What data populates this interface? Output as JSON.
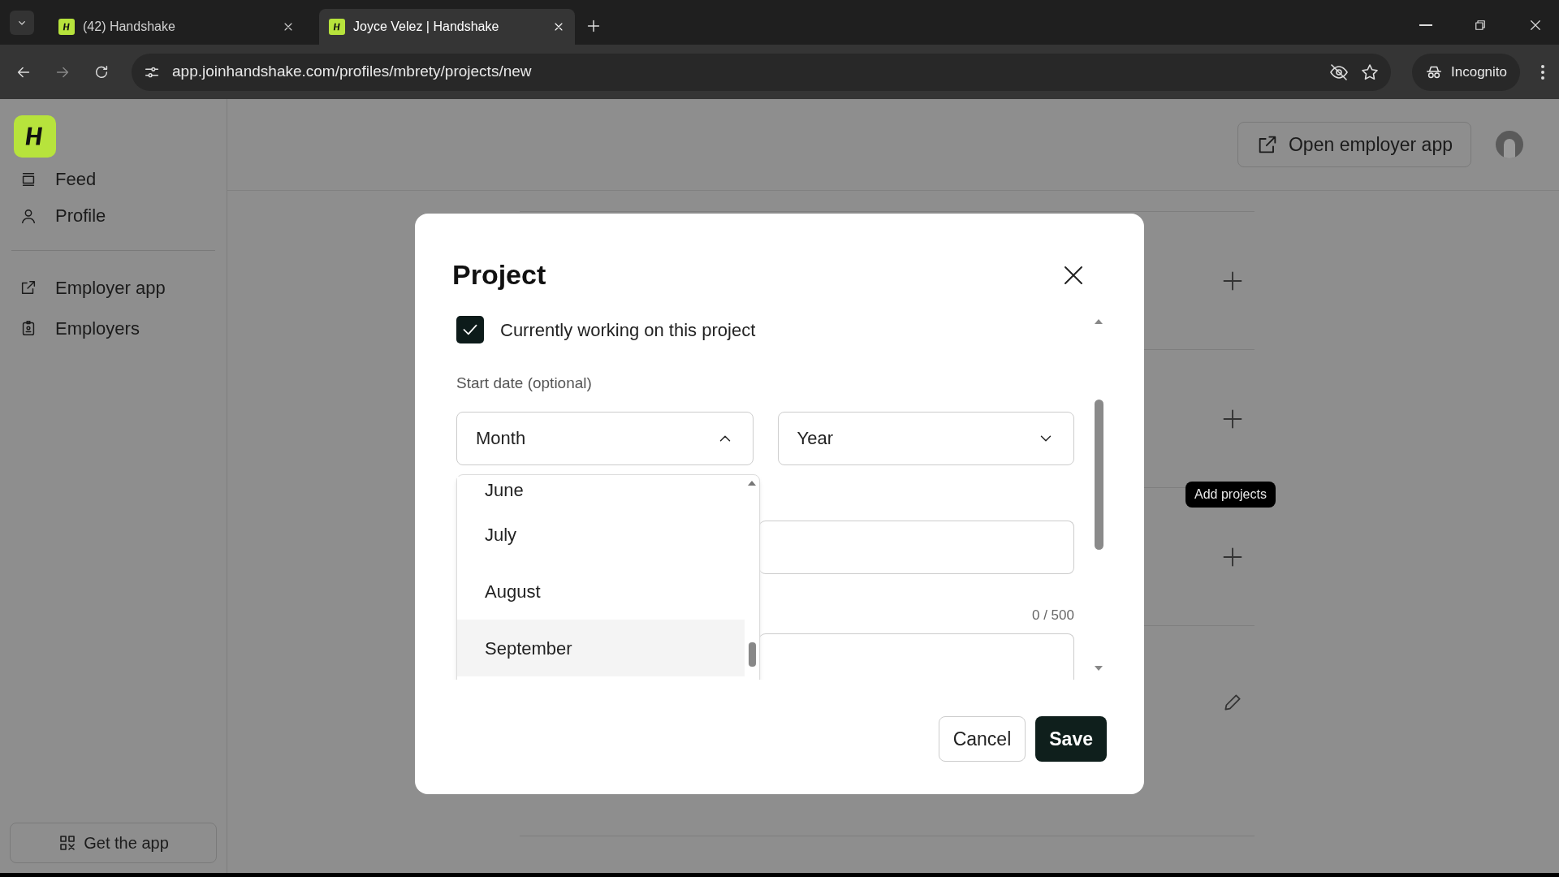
{
  "browser": {
    "tabs": [
      {
        "title": "(42) Handshake",
        "selected": false
      },
      {
        "title": "Joyce Velez | Handshake",
        "selected": true
      }
    ],
    "url": "app.joinhandshake.com/profiles/mbrety/projects/new",
    "profile_label": "Incognito"
  },
  "sidebar": {
    "items": [
      {
        "label": "Feed",
        "kind": "main"
      },
      {
        "label": "Profile",
        "kind": "main"
      },
      {
        "label": "Employer app",
        "kind": "extra"
      },
      {
        "label": "Employers",
        "kind": "extra"
      }
    ],
    "get_app": "Get the app"
  },
  "header": {
    "open_employer_button": "Open employer app"
  },
  "sections": [
    {
      "kind": "add"
    },
    {
      "kind": "add"
    },
    {
      "kind": "add"
    },
    {
      "kind": "edit"
    }
  ],
  "tooltip": "Add projects",
  "modal": {
    "title": "Project",
    "checkbox": {
      "label": "Currently working on this project",
      "checked": true
    },
    "start_date_label": "Start date (optional)",
    "month_select": {
      "value": "Month",
      "expanded": true
    },
    "year_select": {
      "value": "Year",
      "expanded": false
    },
    "month_options": [
      {
        "label": "June",
        "highlighted": false
      },
      {
        "label": "July",
        "highlighted": false
      },
      {
        "label": "August",
        "highlighted": false
      },
      {
        "label": "September",
        "highlighted": true
      }
    ],
    "counter": "0 / 500",
    "buttons": [
      {
        "label": "Cancel",
        "kind": "secondary"
      },
      {
        "label": "Save",
        "kind": "primary"
      }
    ]
  }
}
